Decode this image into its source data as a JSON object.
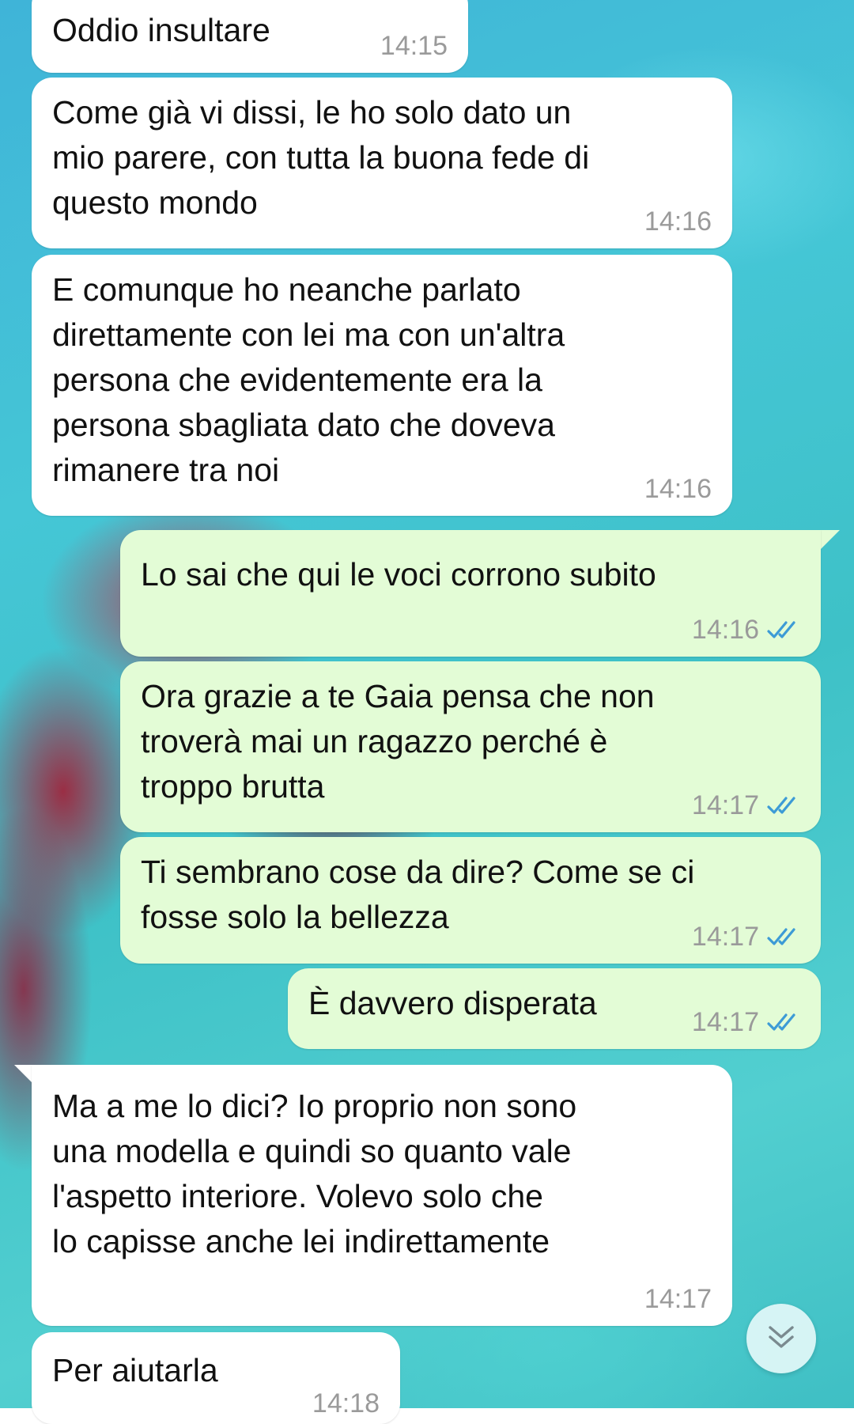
{
  "chat": {
    "messages": [
      {
        "direction": "in",
        "text": "Oddio insultare",
        "time": "14:15"
      },
      {
        "direction": "in",
        "text": "Come già vi dissi, le ho solo dato un\nmio parere, con tutta la buona fede di\nquesto mondo",
        "time": "14:16"
      },
      {
        "direction": "in",
        "text": "E comunque ho neanche parlato\ndirettamente con lei ma con un'altra\npersona che evidentemente era la\npersona sbagliata dato che doveva\nrimanere tra noi",
        "time": "14:16"
      },
      {
        "direction": "out",
        "text": "Lo sai che qui le voci corrono subito",
        "time": "14:16",
        "status": "read"
      },
      {
        "direction": "out",
        "text": "Ora grazie a te Gaia pensa che non\ntroverà mai un ragazzo perché è\ntroppo brutta",
        "time": "14:17",
        "status": "read"
      },
      {
        "direction": "out",
        "text": "Ti sembrano cose da dire? Come se ci\nfosse solo la bellezza",
        "time": "14:17",
        "status": "read"
      },
      {
        "direction": "out",
        "text": "È davvero disperata",
        "time": "14:17",
        "status": "read"
      },
      {
        "direction": "in",
        "text": "Ma a me lo dici? Io proprio non sono\nuna modella e quindi so quanto vale\nl'aspetto interiore. Volevo solo che\nlo capisse anche lei indirettamente",
        "time": "14:17"
      },
      {
        "direction": "in",
        "text": "Per aiutarla",
        "time": "14:18"
      }
    ]
  },
  "colors": {
    "incoming_bubble": "#ffffff",
    "outgoing_bubble": "#e3fcd6",
    "read_ticks": "#3d9bd6",
    "timestamp": "#9a9a9a"
  },
  "icons": {
    "read_receipt": "double-check-icon",
    "scroll_down": "chevron-double-down-icon"
  }
}
